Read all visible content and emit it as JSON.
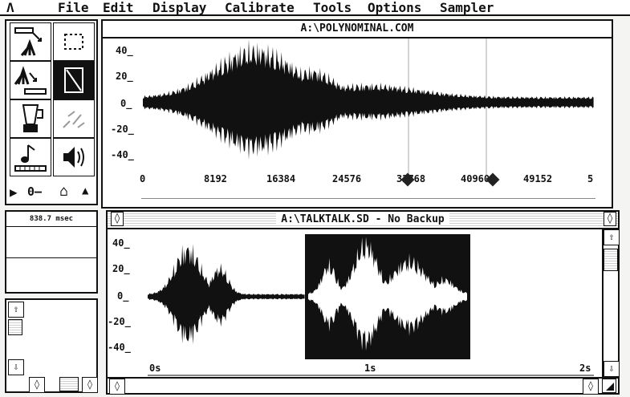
{
  "menu": {
    "logo": "Λ",
    "items": [
      "File",
      "Edit",
      "Display",
      "Calibrate",
      "Tools",
      "Options",
      "Sampler"
    ]
  },
  "window_top": {
    "title": "A:\\POLYNOMINAL.COM",
    "y_labels": [
      "40_",
      "20_",
      "0_",
      "-20_",
      "-40_"
    ],
    "x_labels": [
      "0",
      "8192",
      "16384",
      "24576",
      "32768",
      "40960",
      "49152",
      "5"
    ]
  },
  "window_bottom": {
    "title": "A:\\TALKTALK.SD - No Backup",
    "y_labels": [
      "40_",
      "20_",
      "0_",
      "-20_",
      "-40_"
    ],
    "x_labels": [
      "0s",
      "1s",
      "2s"
    ],
    "close_glyph": "◊",
    "scroll_up": "⇧",
    "scroll_down": "⇩",
    "scroll_left": "◊",
    "scroll_right": "◊"
  },
  "tools": {
    "play": "▶",
    "zero": "0—",
    "home": "⌂",
    "cone": "▲"
  },
  "info": {
    "time_readout": "838.7 msec"
  },
  "left_scroll": {
    "up": "⇧",
    "down": "⇩",
    "left": "◊",
    "right": "◊"
  }
}
